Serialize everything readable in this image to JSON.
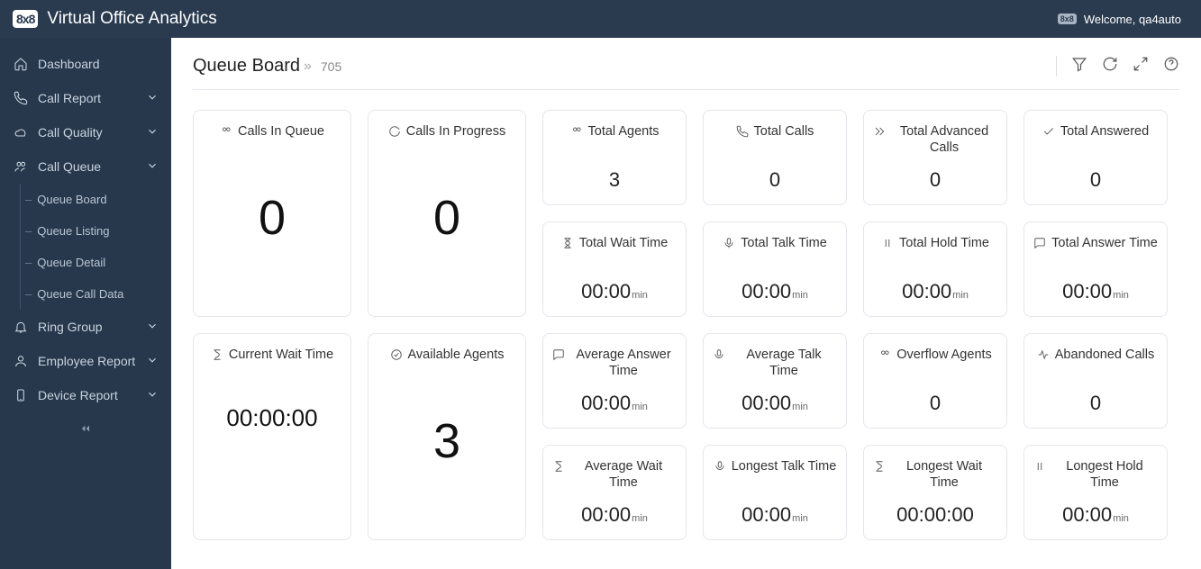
{
  "header": {
    "app_title": "Virtual Office Analytics",
    "welcome": "Welcome, qa4auto"
  },
  "sidebar": {
    "items": [
      {
        "label": "Dashboard"
      },
      {
        "label": "Call Report"
      },
      {
        "label": "Call Quality"
      },
      {
        "label": "Call Queue"
      },
      {
        "label": "Ring Group"
      },
      {
        "label": "Employee Report"
      },
      {
        "label": "Device Report"
      }
    ],
    "sub_items": [
      {
        "label": "Queue Board"
      },
      {
        "label": "Queue Listing"
      },
      {
        "label": "Queue Detail"
      },
      {
        "label": "Queue Call Data"
      }
    ]
  },
  "page": {
    "title": "Queue Board",
    "sub": "705"
  },
  "cards": {
    "calls_in_queue": {
      "title": "Calls In Queue",
      "value": "0"
    },
    "calls_in_progress": {
      "title": "Calls In Progress",
      "value": "0"
    },
    "total_agents": {
      "title": "Total Agents",
      "value": "3"
    },
    "total_calls": {
      "title": "Total Calls",
      "value": "0"
    },
    "total_advanced": {
      "title": "Total Advanced Calls",
      "value": "0"
    },
    "total_answered": {
      "title": "Total Answered",
      "value": "0"
    },
    "total_wait": {
      "title": "Total Wait Time",
      "value": "00:00",
      "unit": "min"
    },
    "total_talk": {
      "title": "Total Talk Time",
      "value": "00:00",
      "unit": "min"
    },
    "total_hold": {
      "title": "Total Hold Time",
      "value": "00:00",
      "unit": "min"
    },
    "total_answer_time": {
      "title": "Total Answer Time",
      "value": "00:00",
      "unit": "min"
    },
    "current_wait": {
      "title": "Current Wait Time",
      "value": "00:00:00"
    },
    "available_agents": {
      "title": "Available Agents",
      "value": "3"
    },
    "avg_answer": {
      "title": "Average Answer Time",
      "value": "00:00",
      "unit": "min"
    },
    "avg_talk": {
      "title": "Average Talk Time",
      "value": "00:00",
      "unit": "min"
    },
    "overflow": {
      "title": "Overflow Agents",
      "value": "0"
    },
    "abandoned": {
      "title": "Abandoned Calls",
      "value": "0"
    },
    "avg_wait": {
      "title": "Average Wait Time",
      "value": "00:00",
      "unit": "min"
    },
    "longest_talk": {
      "title": "Longest Talk Time",
      "value": "00:00",
      "unit": "min"
    },
    "longest_wait": {
      "title": "Longest Wait Time",
      "value": "00:00:00"
    },
    "longest_hold": {
      "title": "Longest Hold Time",
      "value": "00:00",
      "unit": "min"
    }
  }
}
